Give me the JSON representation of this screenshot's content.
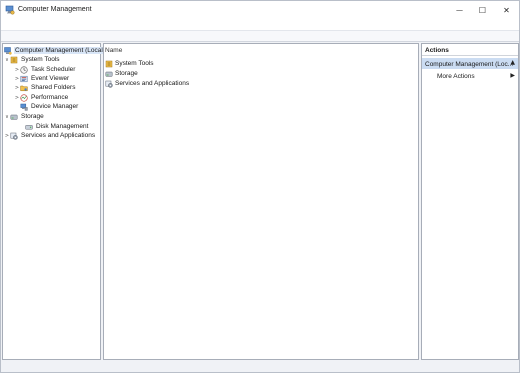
{
  "window": {
    "title": "Computer Management",
    "minimize_glyph": "—",
    "maximize_glyph": "☐",
    "close_glyph": "✕"
  },
  "tree": {
    "root": "Computer Management (Local)",
    "items": [
      {
        "label": "System Tools",
        "icon": "system-tools-icon",
        "expander": "∨"
      },
      {
        "label": "Task Scheduler",
        "icon": "clock-icon",
        "expander": ">"
      },
      {
        "label": "Event Viewer",
        "icon": "event-viewer-icon",
        "expander": ">"
      },
      {
        "label": "Shared Folders",
        "icon": "shared-folders-icon",
        "expander": ">"
      },
      {
        "label": "Performance",
        "icon": "performance-icon",
        "expander": ">"
      },
      {
        "label": "Device Manager",
        "icon": "device-manager-icon",
        "expander": ""
      },
      {
        "label": "Storage",
        "icon": "storage-icon",
        "expander": "∨"
      },
      {
        "label": "Disk Management",
        "icon": "disk-management-icon",
        "expander": ""
      },
      {
        "label": "Services and Applications",
        "icon": "services-icon",
        "expander": ">"
      }
    ]
  },
  "list": {
    "column_name": "Name",
    "rows": [
      "System Tools",
      "Storage",
      "Services and Applications"
    ]
  },
  "actions": {
    "header": "Actions",
    "section": "Computer Management (Loc...",
    "section_arrow": "▲",
    "more_actions": "More Actions",
    "more_arrow": "▶"
  },
  "colors": {
    "selection": "#d9e6f7",
    "actions_section_bg": "#cbdcf2"
  }
}
